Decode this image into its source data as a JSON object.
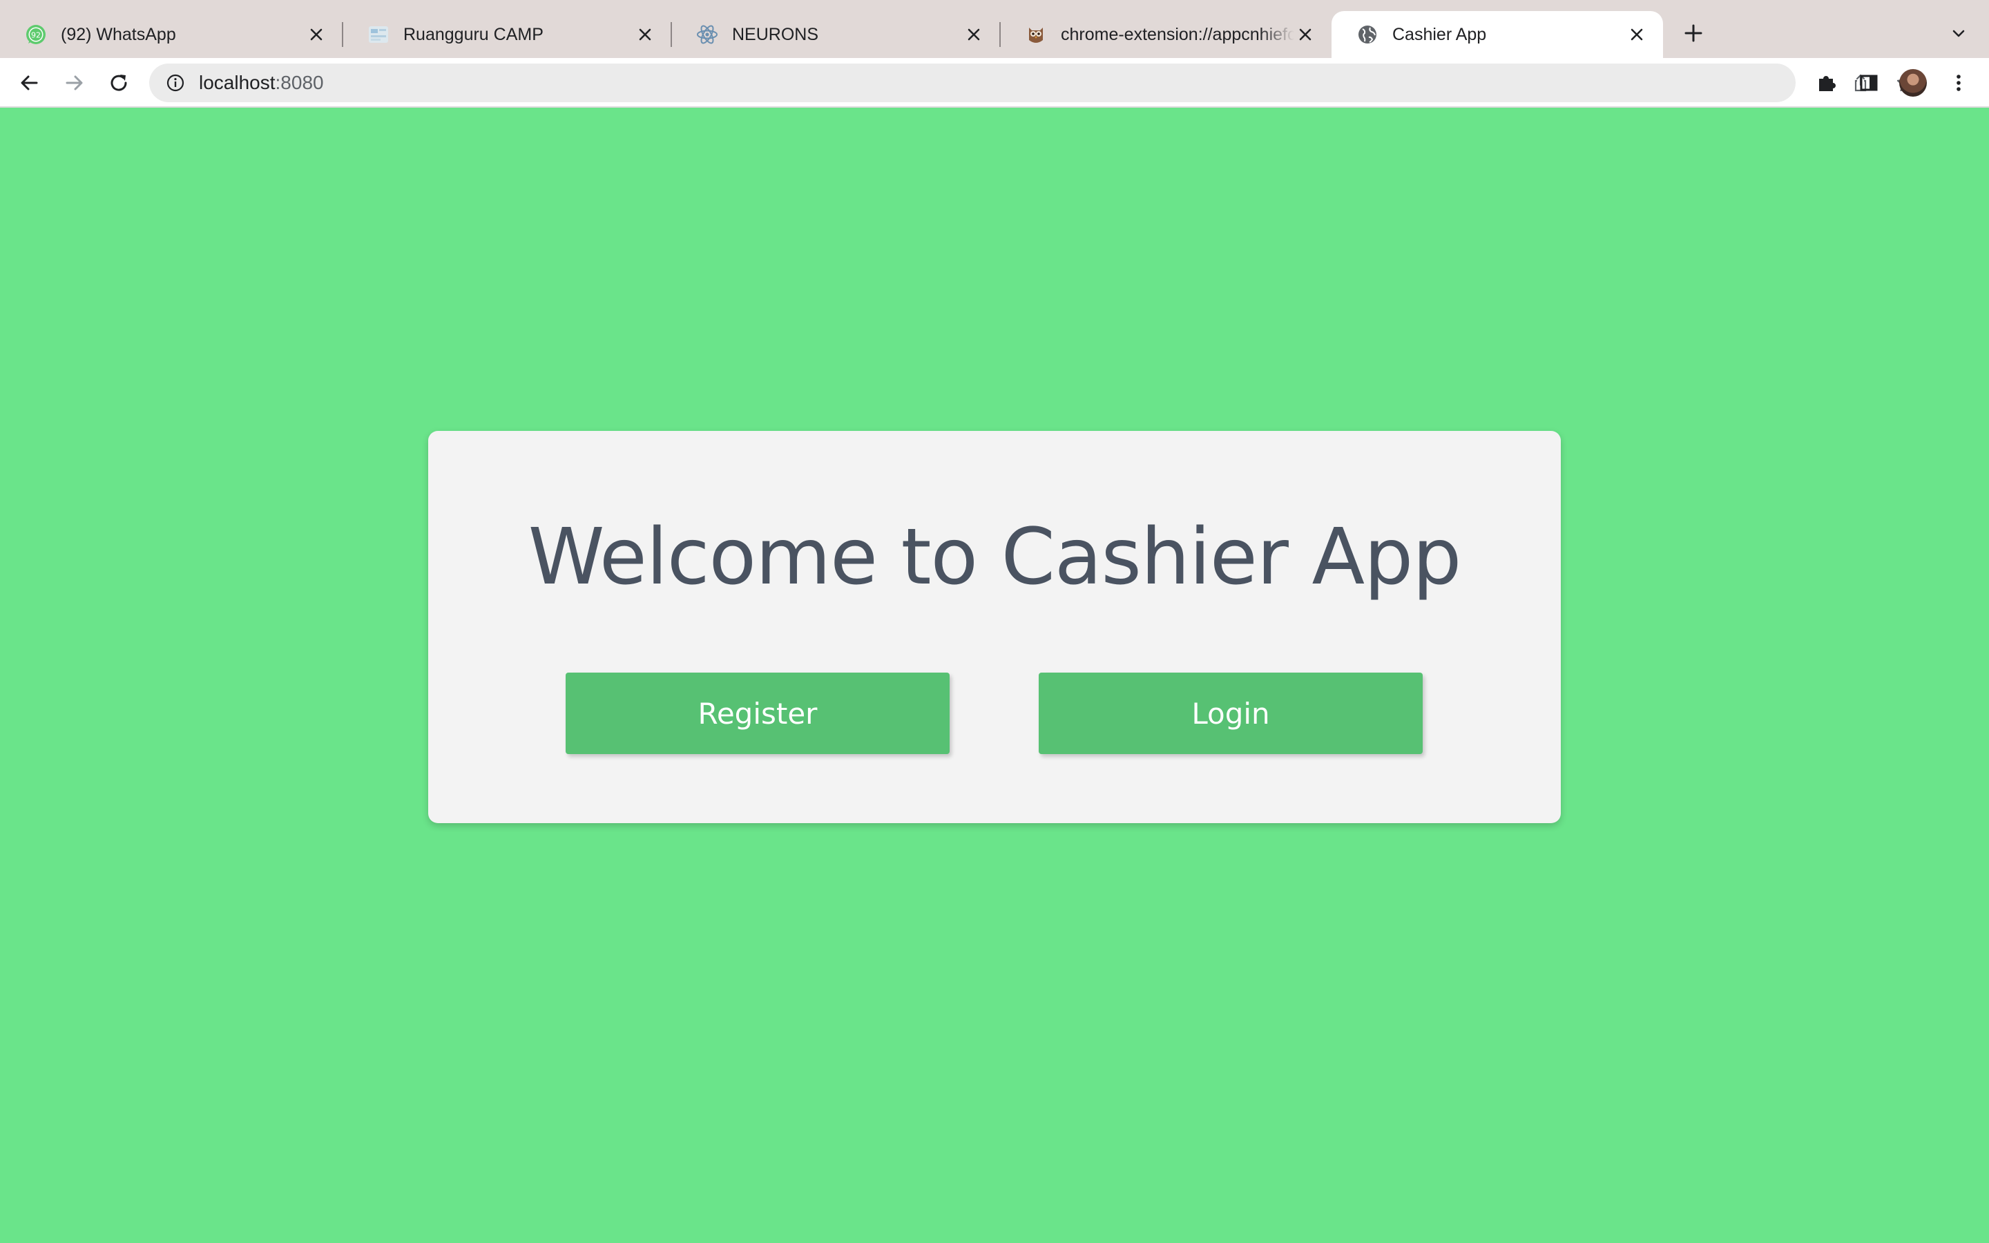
{
  "browser": {
    "tabs": [
      {
        "title": "(92) WhatsApp",
        "favicon": "whatsapp-icon",
        "badge": "92"
      },
      {
        "title": "Ruangguru CAMP",
        "favicon": "ruangguru-icon"
      },
      {
        "title": "NEURONS",
        "favicon": "react-atom-icon"
      },
      {
        "title": "chrome-extension://appcnhiefcidclcdjeahgklghghihfok/index.html",
        "favicon": "owl-icon"
      },
      {
        "title": "Cashier App",
        "favicon": "globe-icon",
        "active": true
      }
    ],
    "address_bar": {
      "host": "localhost",
      "port": ":8080"
    }
  },
  "page": {
    "background_color": "#6ae48a",
    "heading": "Welcome to Cashier App",
    "register_label": "Register",
    "login_label": "Login",
    "button_color": "#57c173"
  }
}
